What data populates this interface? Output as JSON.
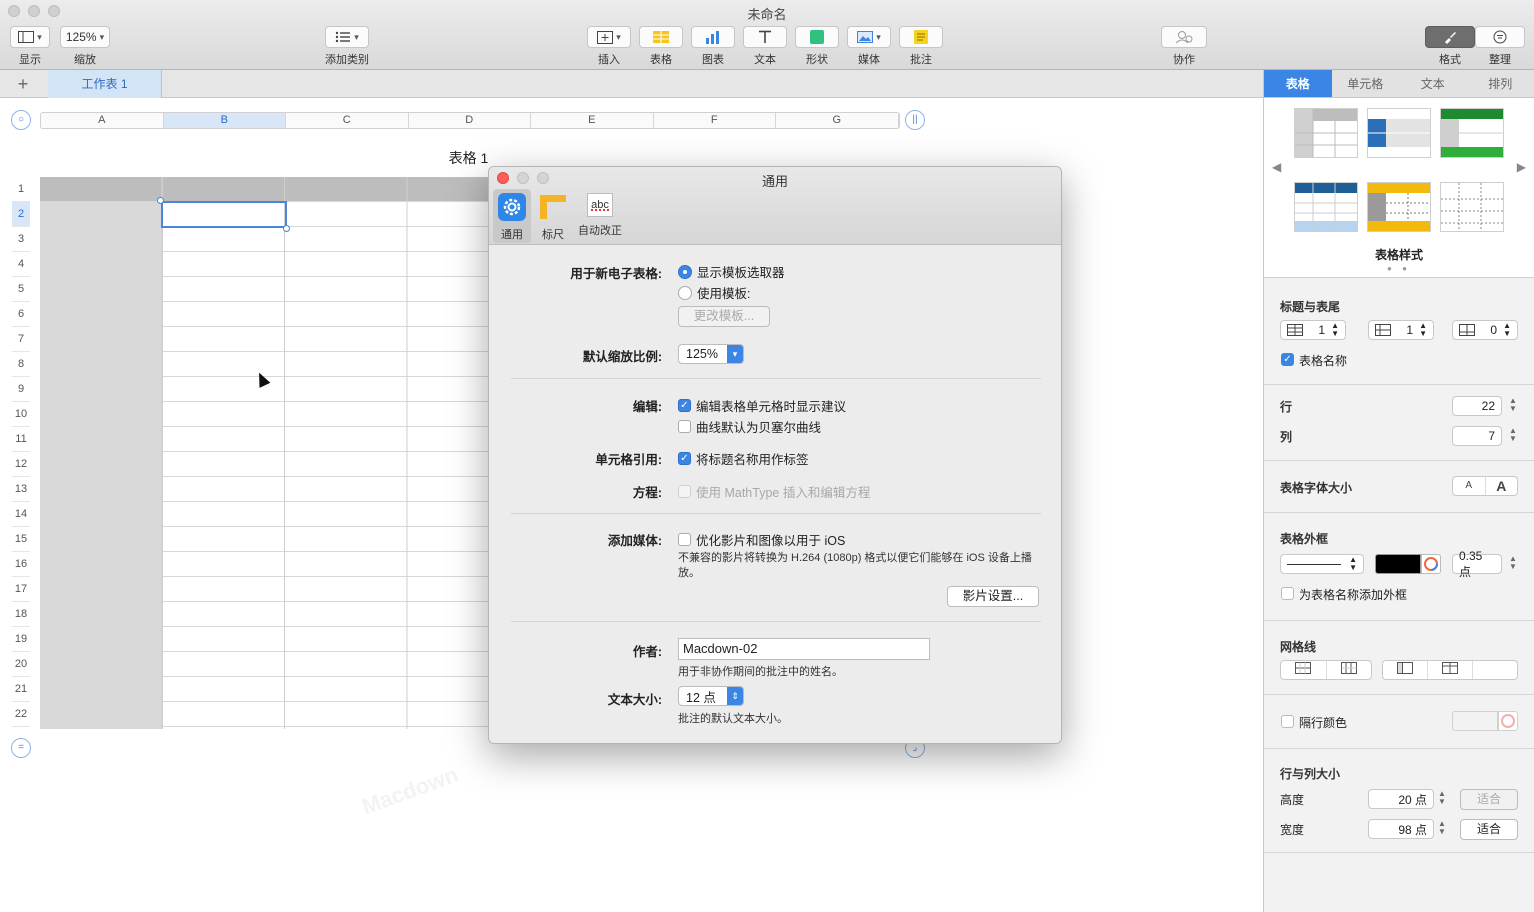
{
  "window": {
    "title": "未命名"
  },
  "toolbar": {
    "view_label": "显示",
    "zoom_value": "125%",
    "zoom_label": "缩放",
    "category_label": "添加类别",
    "insert_label": "插入",
    "table_label": "表格",
    "chart_label": "图表",
    "text_label": "文本",
    "shape_label": "形状",
    "media_label": "媒体",
    "comment_label": "批注",
    "collab_label": "协作",
    "format_label": "格式",
    "organize_label": "整理"
  },
  "sheet": {
    "add_symbol": "+",
    "tab_name": "工作表 1",
    "table_title": "表格 1",
    "columns": [
      "A",
      "B",
      "C",
      "D",
      "E",
      "F",
      "G"
    ],
    "rows": [
      "1",
      "2",
      "3",
      "4",
      "5",
      "6",
      "7",
      "8",
      "9",
      "10",
      "11",
      "12",
      "13",
      "14",
      "15",
      "16",
      "17",
      "18",
      "19",
      "20",
      "21",
      "22"
    ],
    "selected_column": "B",
    "selected_row": "2"
  },
  "inspector": {
    "tabs": [
      "表格",
      "单元格",
      "文本",
      "排列"
    ],
    "active_tab": "表格",
    "styles_label": "表格样式",
    "header_footer_title": "标题与表尾",
    "header_rows": "1",
    "header_cols": "1",
    "footer_rows": "0",
    "table_name_label": "表格名称",
    "rows_label": "行",
    "rows_value": "22",
    "cols_label": "列",
    "cols_value": "7",
    "font_size_title": "表格字体大小",
    "font_small": "A",
    "font_large": "A",
    "outline_title": "表格外框",
    "outline_width": "0.35 点",
    "outline_name_label": "为表格名称添加外框",
    "gridlines_title": "网格线",
    "alt_row_label": "隔行颜色",
    "row_col_size_title": "行与列大小",
    "height_label": "高度",
    "height_value": "20 点",
    "width_label": "宽度",
    "width_value": "98 点",
    "fit_label": "适合",
    "colors": {
      "accent": "#3b86e4"
    }
  },
  "dialog": {
    "title": "通用",
    "tabs": [
      {
        "label": "通用",
        "icon": "gear-icon"
      },
      {
        "label": "标尺",
        "icon": "ruler-icon"
      },
      {
        "label": "自动改正",
        "icon": "abc-icon",
        "icon_text": "abc"
      }
    ],
    "new_sheet_label": "用于新电子表格:",
    "opt_show_chooser": "显示模板选取器",
    "opt_use_template": "使用模板:",
    "change_template_btn": "更改模板...",
    "default_zoom_label": "默认缩放比例:",
    "default_zoom_value": "125%",
    "edit_label": "编辑:",
    "edit_opt1": "编辑表格单元格时显示建议",
    "edit_opt2": "曲线默认为贝塞尔曲线",
    "cell_ref_label": "单元格引用:",
    "cell_ref_opt": "将标题名称用作标签",
    "equation_label": "方程:",
    "equation_opt": "使用 MathType 插入和编辑方程",
    "media_label": "添加媒体:",
    "media_opt": "优化影片和图像以用于 iOS",
    "media_note": "不兼容的影片将转换为 H.264 (1080p) 格式以便它们能够在 iOS 设备上播放。",
    "movie_settings_btn": "影片设置...",
    "author_label": "作者:",
    "author_value": "Macdown-02",
    "author_note": "用于非协作期间的批注中的姓名。",
    "text_size_label": "文本大小:",
    "text_size_value": "12 点",
    "text_size_note": "批注的默认文本大小。"
  }
}
